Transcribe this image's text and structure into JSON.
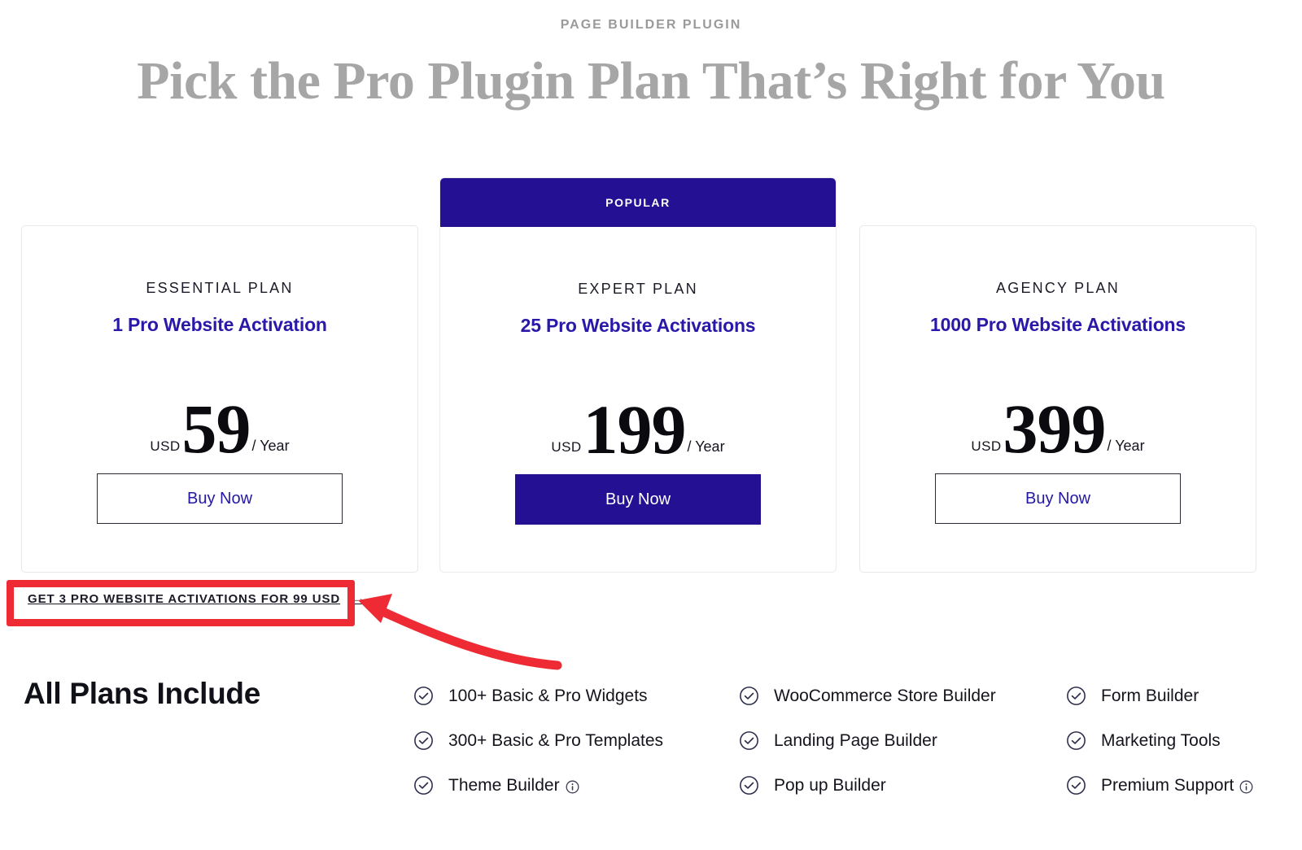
{
  "header": {
    "eyebrow": "PAGE BUILDER PLUGIN",
    "headline": "Pick the Pro Plugin Plan That’s Right for You"
  },
  "colors": {
    "brand_navy": "#231093",
    "brand_indigo_text": "#2a18a8",
    "annotation_red": "#ee2b34",
    "heading_gray": "#a6a6a6",
    "eyebrow_gray": "#9a9a9a"
  },
  "plans": [
    {
      "badge": "",
      "name": "ESSENTIAL PLAN",
      "subtitle": "1 Pro Website Activation",
      "currency": "USD",
      "amount": "59",
      "period": "/ Year",
      "cta": "Buy Now",
      "featured": false
    },
    {
      "badge": "POPULAR",
      "name": "EXPERT PLAN",
      "subtitle": "25 Pro Website Activations",
      "currency": "USD",
      "amount": "199",
      "period": "/ Year",
      "cta": "Buy Now",
      "featured": true
    },
    {
      "badge": "",
      "name": "AGENCY PLAN",
      "subtitle": "1000 Pro Website Activations",
      "currency": "USD",
      "amount": "399",
      "period": "/ Year",
      "cta": "Buy Now",
      "featured": false
    }
  ],
  "promo": {
    "label": "GET 3 PRO WEBSITE ACTIVATIONS FOR 99 USD",
    "arrow": "→"
  },
  "features": {
    "title": "All Plans Include",
    "columns": [
      [
        {
          "label": "100+ Basic & Pro Widgets",
          "info": false
        },
        {
          "label": "300+ Basic & Pro Templates",
          "info": false
        },
        {
          "label": "Theme Builder",
          "info": true
        }
      ],
      [
        {
          "label": "WooCommerce Store Builder",
          "info": false
        },
        {
          "label": "Landing Page Builder",
          "info": false
        },
        {
          "label": "Pop up Builder",
          "info": false
        }
      ],
      [
        {
          "label": "Form Builder",
          "info": false
        },
        {
          "label": "Marketing Tools",
          "info": false
        },
        {
          "label": "Premium Support",
          "info": true
        }
      ]
    ]
  },
  "annotations": {
    "highlight_target": "promo-link",
    "arrow_direction": "points-left-to-promo-link"
  }
}
